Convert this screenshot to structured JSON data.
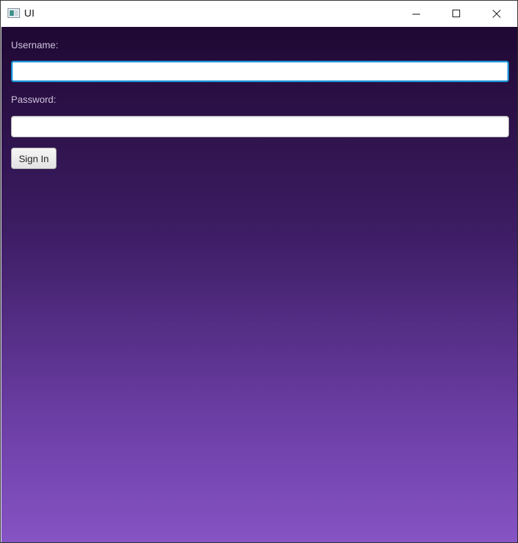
{
  "window": {
    "title": "UI"
  },
  "form": {
    "username_label": "Username:",
    "username_value": "",
    "password_label": "Password:",
    "password_value": "",
    "signin_label": "Sign In"
  },
  "colors": {
    "gradient_top": "#1f0833",
    "gradient_bottom": "#8654c4",
    "focus_border": "#1a8fd6"
  },
  "icons": {
    "app": "app-window-icon",
    "minimize": "minimize-icon",
    "maximize": "maximize-icon",
    "close": "close-icon"
  }
}
